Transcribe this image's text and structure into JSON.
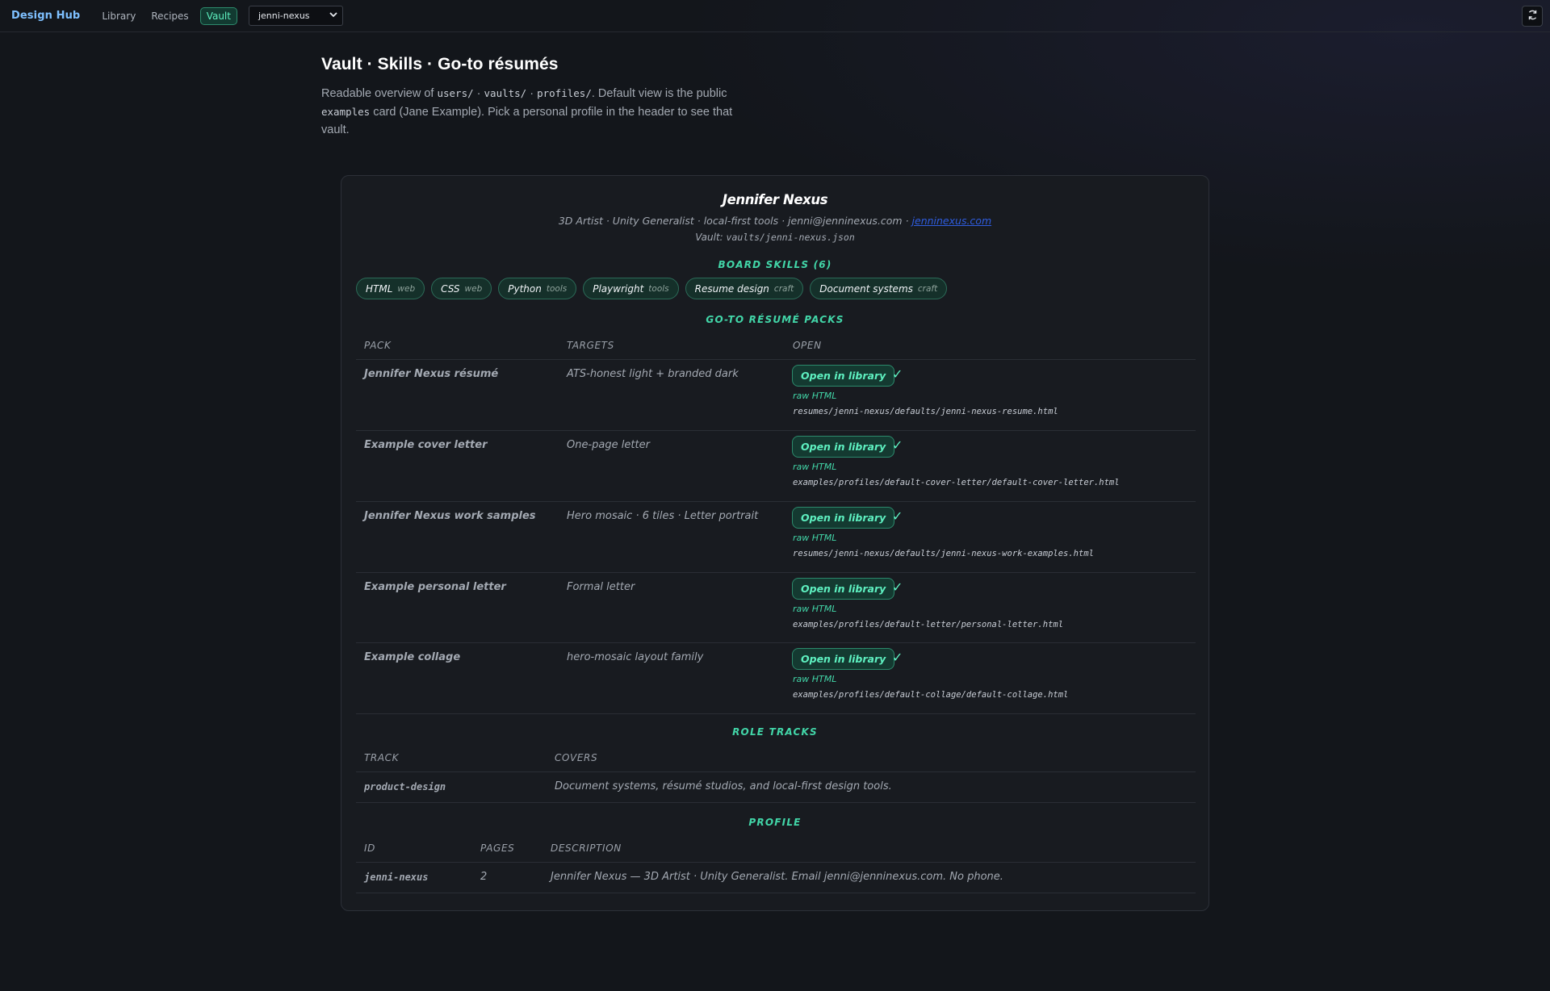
{
  "header": {
    "brand": "Design Hub",
    "nav": [
      {
        "label": "Library"
      },
      {
        "label": "Recipes"
      },
      {
        "label": "Vault"
      }
    ],
    "profile_select": {
      "value": "jenni-nexus"
    },
    "refresh_icon": "refresh-icon"
  },
  "intro": {
    "title": "Vault · Skills · Go-to résumés",
    "t1": "Readable overview of ",
    "c1": "users/",
    "t2": " · ",
    "c2": "vaults/",
    "t3": " · ",
    "c3": "profiles/",
    "t4": ". Default view is the public ",
    "c4": "examples",
    "t5": " card (Jane Example). Pick a personal profile in the header to see that vault."
  },
  "card": {
    "name": "Jennifer Nexus",
    "subline_text": "3D Artist · Unity Generalist · local-first tools · jenni@jenninexus.com · ",
    "subline_link": "jenninexus.com",
    "vault_label": "Vault: ",
    "vault_path": "vaults/jenni-nexus.json",
    "skills_heading": "BOARD SKILLS (6)",
    "skills": [
      {
        "name": "HTML",
        "cat": "web"
      },
      {
        "name": "CSS",
        "cat": "web"
      },
      {
        "name": "Python",
        "cat": "tools"
      },
      {
        "name": "Playwright",
        "cat": "tools"
      },
      {
        "name": "Resume design",
        "cat": "craft"
      },
      {
        "name": "Document systems",
        "cat": "craft"
      }
    ],
    "packs_heading": "GO-TO RÉSUMÉ PACKS",
    "packs_columns": {
      "pack": "PACK",
      "targets": "TARGETS",
      "open": "OPEN"
    },
    "packs": [
      {
        "name": "Jennifer Nexus résumé",
        "targets": "ATS-honest light + branded dark",
        "button": "Open in library",
        "check": "✓",
        "raw": "raw HTML",
        "path": "resumes/jenni-nexus/defaults/jenni-nexus-resume.html"
      },
      {
        "name": "Example cover letter",
        "targets": "One-page letter",
        "button": "Open in library",
        "check": "✓",
        "raw": "raw HTML",
        "path": "examples/profiles/default-cover-letter/default-cover-letter.html"
      },
      {
        "name": "Jennifer Nexus work samples",
        "targets": "Hero mosaic · 6 tiles · Letter portrait",
        "button": "Open in library",
        "check": "✓",
        "raw": "raw HTML",
        "path": "resumes/jenni-nexus/defaults/jenni-nexus-work-examples.html"
      },
      {
        "name": "Example personal letter",
        "targets": "Formal letter",
        "button": "Open in library",
        "check": "✓",
        "raw": "raw HTML",
        "path": "examples/profiles/default-letter/personal-letter.html"
      },
      {
        "name": "Example collage",
        "targets": "hero-mosaic layout family",
        "button": "Open in library",
        "check": "✓",
        "raw": "raw HTML",
        "path": "examples/profiles/default-collage/default-collage.html"
      }
    ],
    "tracks_heading": "ROLE TRACKS",
    "tracks_columns": {
      "track": "TRACK",
      "covers": "COVERS"
    },
    "tracks": [
      {
        "track": "product-design",
        "covers": "Document systems, résumé studios, and local-first design tools."
      }
    ],
    "profile_heading": "PROFILE",
    "profile_columns": {
      "id": "ID",
      "pages": "PAGES",
      "description": "DESCRIPTION"
    },
    "profiles": [
      {
        "id": "jenni-nexus",
        "pages": "2",
        "description": "Jennifer Nexus — 3D Artist · Unity Generalist. Email jenni@jenninexus.com. No phone."
      }
    ]
  }
}
